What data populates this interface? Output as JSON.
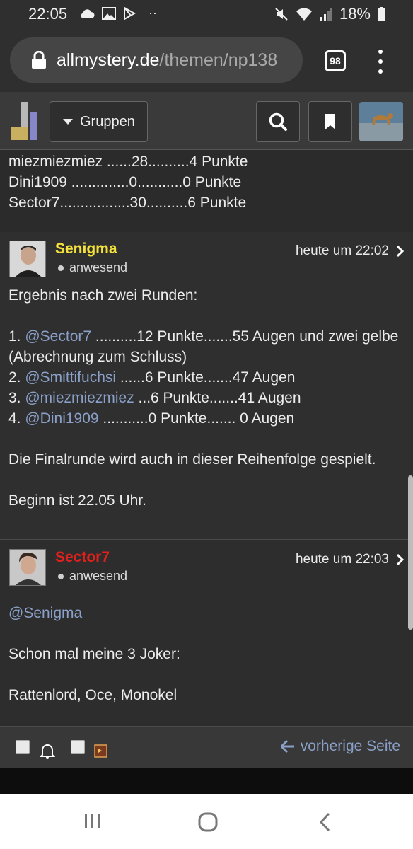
{
  "status_bar": {
    "time": "22:05",
    "dots": "··",
    "battery": "18%"
  },
  "browser": {
    "url_host": "allmystery.de",
    "url_path": "/themen/np138",
    "tab_count": "98"
  },
  "header": {
    "groups_label": "Gruppen"
  },
  "prev_post_lines": [
    "miezmiezmiez ......28..........4 Punkte",
    "Dini1909 ..............0...........0 Punkte",
    "Sector7.................30..........6 Punkte"
  ],
  "posts": [
    {
      "user": "Senigma",
      "user_color": "#f4e23b",
      "status": "anwesend",
      "time": "heute um 22:02",
      "line1": "Ergebnis nach zwei Runden:",
      "r1_pre": "1. ",
      "r1_m": "@Sector7",
      "r1_post": " ..........12 Punkte.......55 Augen und zwei gelbe (Abrechnung zum Schluss)",
      "r2_pre": "2. ",
      "r2_m": "@Smittifuchsi",
      "r2_post": " ......6 Punkte.......47 Augen",
      "r3_pre": "3. ",
      "r3_m": "@miezmiezmiez",
      "r3_post": " ...6 Punkte.......41 Augen",
      "r4_pre": "4. ",
      "r4_m": "@Dini1909",
      "r4_post": " ...........0 Punkte....... 0 Augen",
      "line_final": "Die Finalrunde wird auch in dieser Reihenfolge gespielt.",
      "line_start": "Beginn ist 22.05 Uhr."
    },
    {
      "user": "Sector7",
      "user_color": "#e0201c",
      "status": "anwesend",
      "time": "heute um 22:03",
      "mention": "@Senigma",
      "line1": "Schon mal meine 3 Joker:",
      "line2": "Rattenlord, Oce, Monokel"
    }
  ],
  "bottom": {
    "prev_page": "vorherige Seite"
  }
}
